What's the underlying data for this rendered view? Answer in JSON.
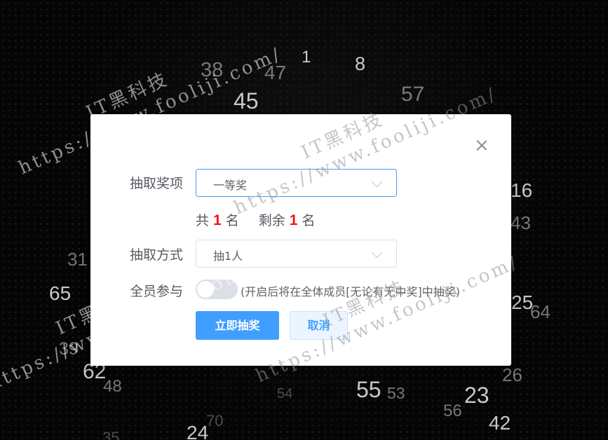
{
  "background_numbers": [
    "1",
    "8",
    "38",
    "47",
    "45",
    "57",
    "16",
    "43",
    "31",
    "65",
    "25",
    "64",
    "39",
    "62",
    "48",
    "55",
    "53",
    "54",
    "23",
    "26",
    "56",
    "42",
    "24",
    "70",
    "35"
  ],
  "modal": {
    "prize_label": "抽取奖项",
    "prize_value": "一等奖",
    "count_total_prefix": "共",
    "count_total": "1",
    "count_total_suffix": "名",
    "count_remaining_prefix": "剩余",
    "count_remaining": "1",
    "count_remaining_suffix": "名",
    "mode_label": "抽取方式",
    "mode_value": "抽1人",
    "all_members_label": "全员参与",
    "all_members_enabled": false,
    "all_members_hint": "(开启后将在全体成员[无论有无中奖]中抽奖)",
    "draw_button": "立即抽奖",
    "cancel_button": "取消"
  },
  "watermark": {
    "brand": "IT黑科技",
    "url": "https://www.fooliji.com/"
  },
  "colors": {
    "primary": "#409eff",
    "count_highlight": "#f01515",
    "modal_bg": "#ffffff",
    "page_bg": "#050505"
  }
}
